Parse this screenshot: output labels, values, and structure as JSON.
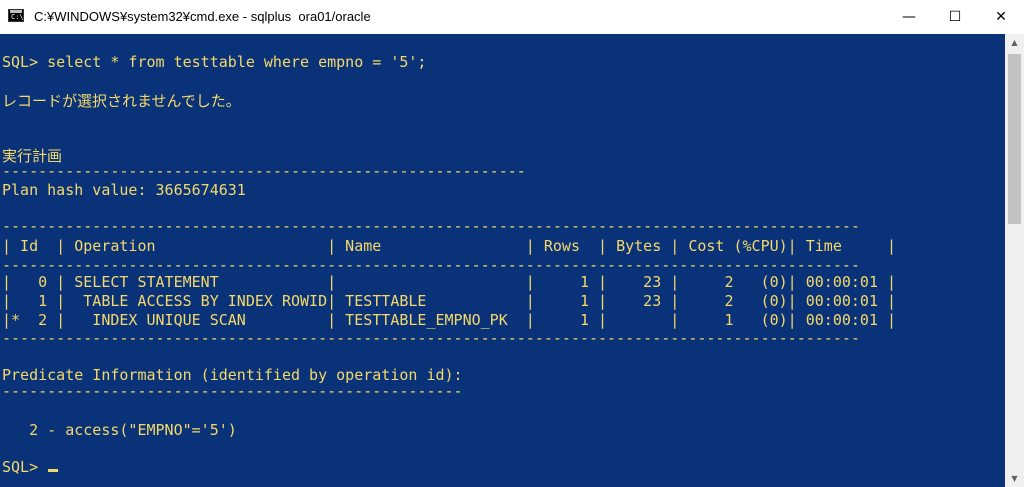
{
  "window": {
    "title": "C:¥WINDOWS¥system32¥cmd.exe - sqlplus  ora01/oracle",
    "icon": "cmd-icon",
    "icon_text": "C:\\",
    "controls": {
      "minimize": "—",
      "maximize": "☐",
      "close": "✕"
    }
  },
  "console": {
    "colors": {
      "background": "#0a3278",
      "text": "#f4d96a"
    },
    "lines": [
      "SQL> select * from testtable where empno = '5';",
      "レコードが選択されませんでした。",
      "実行計画",
      "----------------------------------------------------------",
      "Plan hash value: 3665674631",
      "-----------------------------------------------------------------------------------------------",
      "| Id  | Operation                   | Name                | Rows  | Bytes | Cost (%CPU)| Time     |",
      "-----------------------------------------------------------------------------------------------",
      "|   0 | SELECT STATEMENT            |                     |     1 |    23 |     2   (0)| 00:00:01 |",
      "|   1 |  TABLE ACCESS BY INDEX ROWID| TESTTABLE           |     1 |    23 |     2   (0)| 00:00:01 |",
      "|*  2 |   INDEX UNIQUE SCAN         | TESTTABLE_EMPNO_PK  |     1 |       |     1   (0)| 00:00:01 |",
      "-----------------------------------------------------------------------------------------------",
      "Predicate Information (identified by operation id):",
      "---------------------------------------------------",
      "   2 - access(\"EMPNO\"='5')"
    ],
    "prompt": "SQL> "
  },
  "scrollbar": {
    "up": "▲",
    "down": "▼"
  }
}
